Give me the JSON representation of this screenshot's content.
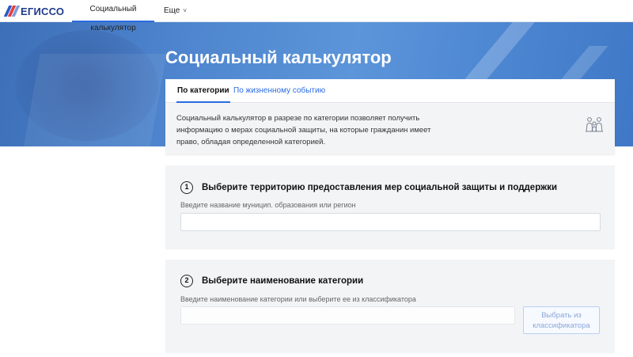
{
  "header": {
    "logo_text": "ЕГИССО",
    "nav": [
      {
        "label": "Социальный калькулятор",
        "active": true
      },
      {
        "label": "Еще"
      }
    ],
    "more_chevron": "˅"
  },
  "hero": {
    "title": "Социальный калькулятор"
  },
  "tabs": [
    {
      "label": "По категории",
      "active": true
    },
    {
      "label": "По жизненному событию"
    }
  ],
  "description": "Социальный калькулятор в разрезе по категории позволяет получить информацию о мерах социальной защиты, на которые гражданин имеет право, обладая определенной категорией.",
  "steps": [
    {
      "number": "1",
      "title": "Выберите территорию предоставления мер социальной защиты и поддержки",
      "field_label": "Введите название муницип. образования или регион",
      "value": ""
    },
    {
      "number": "2",
      "title": "Выберите наименование категории",
      "field_label": "Введите наименование категории или выберите ее из классификатора",
      "value": "",
      "button_label": "Выбрать из классификатора"
    }
  ],
  "icons": {
    "logo": "egisso-logo-icon",
    "people": "family-icon"
  },
  "colors": {
    "accent": "#2b6be0",
    "hero": "#4f86cf",
    "section_bg": "#f3f4f6"
  }
}
